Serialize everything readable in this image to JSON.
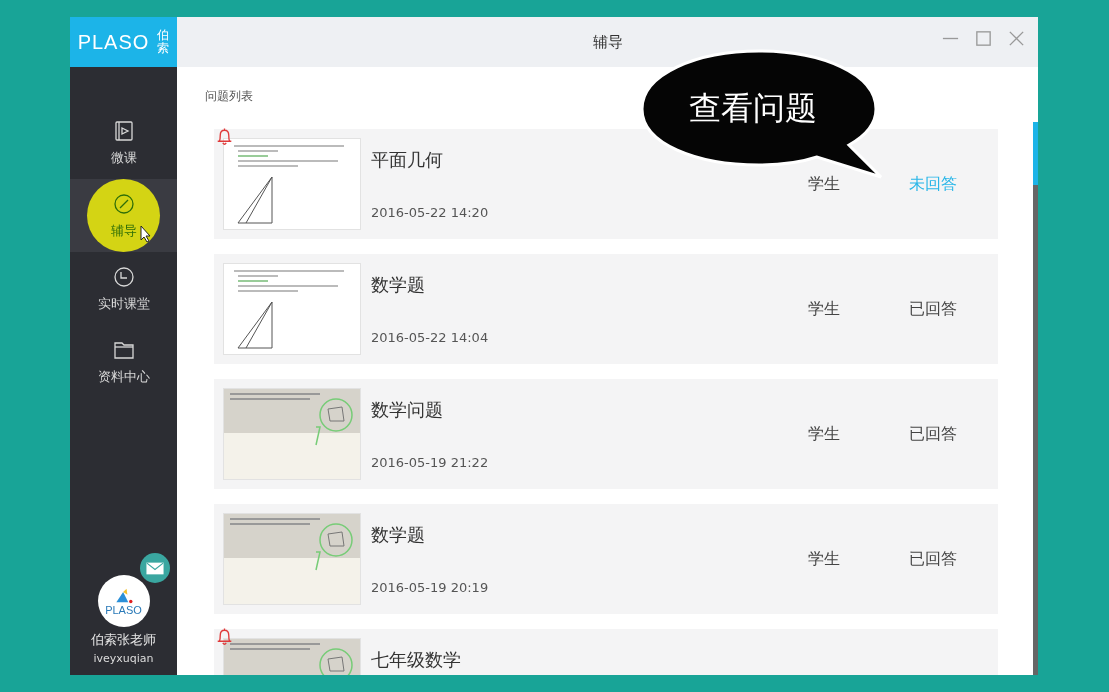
{
  "logo": {
    "wordmark": "PLASO",
    "chinese": "伯索"
  },
  "window": {
    "title": "辅导"
  },
  "sidebar": {
    "items": [
      {
        "label": "微课",
        "selected": false
      },
      {
        "label": "辅导",
        "selected": true
      },
      {
        "label": "实时课堂",
        "selected": false
      },
      {
        "label": "资料中心",
        "selected": false
      }
    ],
    "user": {
      "avatar_text": "PLASO",
      "name": "伯索张老师",
      "handle": "iveyxuqian",
      "unread": true
    }
  },
  "section_title": "问题列表",
  "questions": [
    {
      "title": "平面几何",
      "date": "2016-05-22 14:20",
      "asker": "学生",
      "status": "未回答",
      "answered": false,
      "alert": true
    },
    {
      "title": "数学题",
      "date": "2016-05-22 14:04",
      "asker": "学生",
      "status": "已回答",
      "answered": true,
      "alert": false
    },
    {
      "title": "数学问题",
      "date": "2016-05-19 21:22",
      "asker": "学生",
      "status": "已回答",
      "answered": true,
      "alert": false
    },
    {
      "title": "数学题",
      "date": "2016-05-19 20:19",
      "asker": "学生",
      "status": "已回答",
      "answered": true,
      "alert": false
    },
    {
      "title": "七年级数学",
      "alert": true
    }
  ],
  "callout": {
    "text": "查看问题"
  }
}
